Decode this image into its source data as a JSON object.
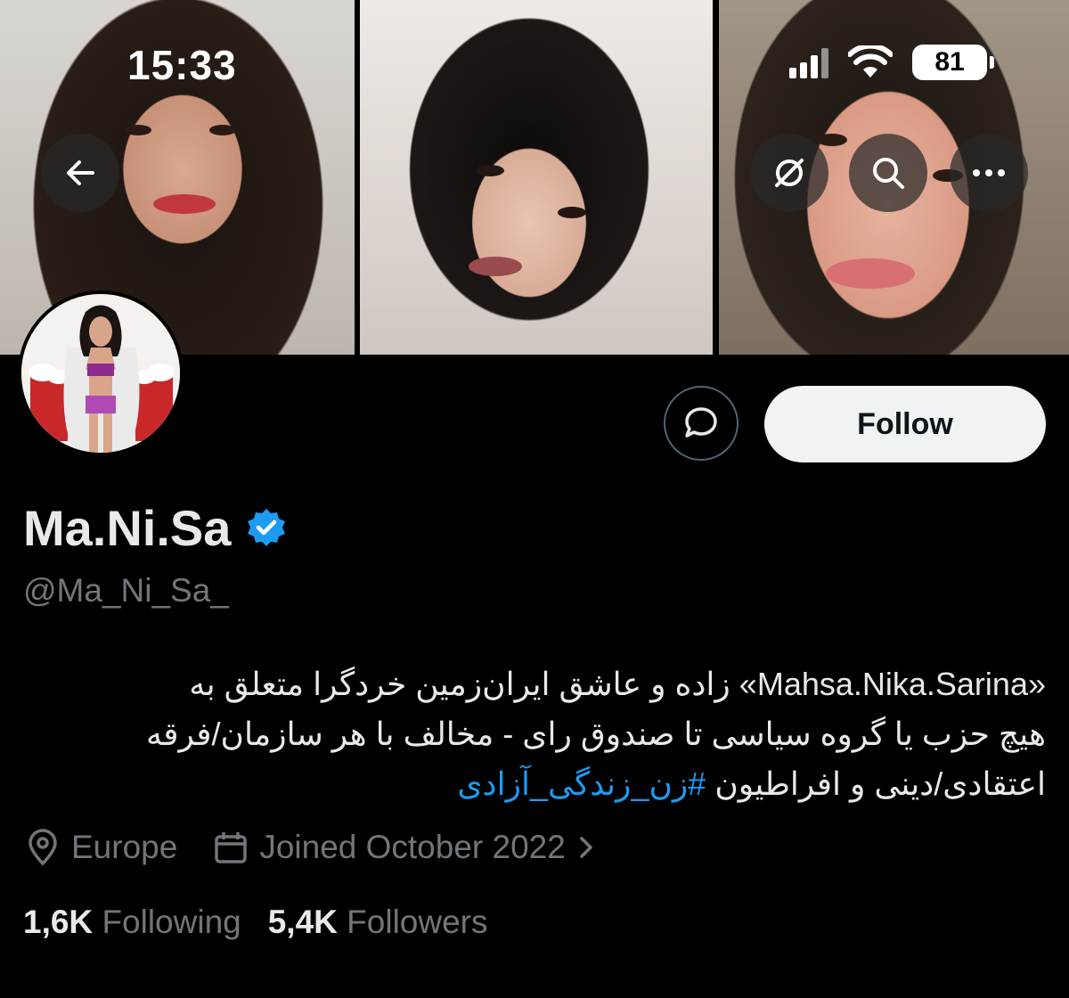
{
  "status_bar": {
    "time": "15:33",
    "battery": "81"
  },
  "header": {
    "back_icon": "arrow-left-icon",
    "actions": [
      "translate-off-icon",
      "search-icon",
      "more-icon"
    ]
  },
  "profile": {
    "display_name": "Ma.Ni.Sa",
    "handle": "@Ma_Ni_Sa_",
    "verified": true,
    "bio_line1": "«Mahsa.Nika.Sarina» زاده و عاشق ایران‌زمین خردگرا متعلق به",
    "bio_line2": "هیچ حزب یا گروه سیاسی تا صندوق رای - مخالف با هر سازمان/فرقه",
    "bio_line3_text": "اعتقادی/دینی و افراطیون ",
    "bio_hashtag": "#زن_زندگی_آزادی",
    "location": "Europe",
    "joined": "Joined October 2022",
    "following_count": "1,6K",
    "following_label": "Following",
    "followers_count": "5,4K",
    "followers_label": "Followers"
  },
  "buttons": {
    "follow": "Follow",
    "message_icon": "message-icon"
  },
  "colors": {
    "background": "#000000",
    "accent": "#1d9bf0",
    "muted": "#71767b",
    "text": "#e7e9ea",
    "follow_bg": "#eff3f4"
  }
}
